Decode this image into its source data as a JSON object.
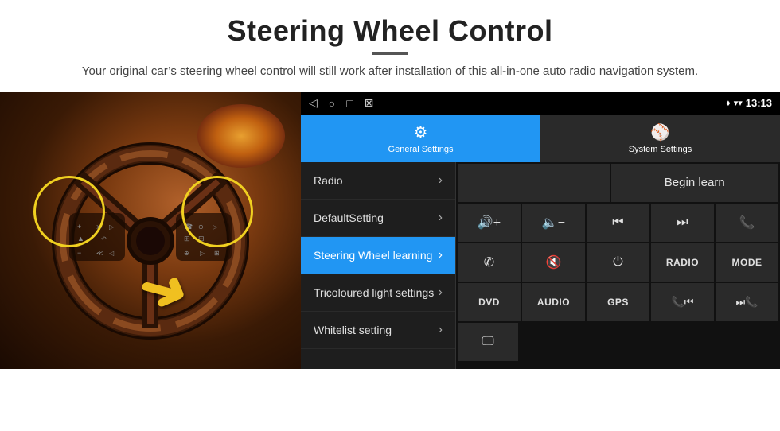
{
  "header": {
    "title": "Steering Wheel Control",
    "divider": true,
    "subtitle": "Your original car’s steering wheel control will still work after installation of this all-in-one auto radio navigation system."
  },
  "status_bar": {
    "nav_icons": [
      "◁",
      "○",
      "□",
      "☒"
    ],
    "signal_icon": "▾▾",
    "wifi_icon": "▾",
    "time": "13:13"
  },
  "tabs": [
    {
      "label": "General Settings",
      "icon": "⚙",
      "active": true
    },
    {
      "label": "System Settings",
      "icon": "⚾",
      "active": false
    }
  ],
  "menu": {
    "items": [
      {
        "label": "Radio",
        "active": false
      },
      {
        "label": "DefaultSetting",
        "active": false
      },
      {
        "label": "Steering Wheel learning",
        "active": true
      },
      {
        "label": "Tricoloured light settings",
        "active": false
      },
      {
        "label": "Whitelist setting",
        "active": false
      }
    ]
  },
  "controls": {
    "begin_learn_label": "Begin learn",
    "row1": [
      {
        "icon": "🔊+",
        "label": "vol-up"
      },
      {
        "icon": "🔈−",
        "label": "vol-down"
      },
      {
        "icon": "⏮",
        "label": "prev-track"
      },
      {
        "icon": "⏭",
        "label": "next-track"
      },
      {
        "icon": "☎",
        "label": "phone"
      }
    ],
    "row2": [
      {
        "icon": "☓",
        "label": "hang-up"
      },
      {
        "icon": "🔇✕",
        "label": "mute"
      },
      {
        "icon": "⏻",
        "label": "power"
      },
      {
        "text": "RADIO",
        "label": "radio-btn"
      },
      {
        "text": "MODE",
        "label": "mode-btn"
      }
    ],
    "row3": [
      {
        "text": "DVD",
        "label": "dvd-btn"
      },
      {
        "text": "AUDIO",
        "label": "audio-btn"
      },
      {
        "text": "GPS",
        "label": "gps-btn"
      },
      {
        "icon": "📞⏮",
        "label": "tel-prev"
      },
      {
        "icon": "⏯⏭",
        "label": "tel-next"
      }
    ],
    "row4_icon": "🖵"
  }
}
